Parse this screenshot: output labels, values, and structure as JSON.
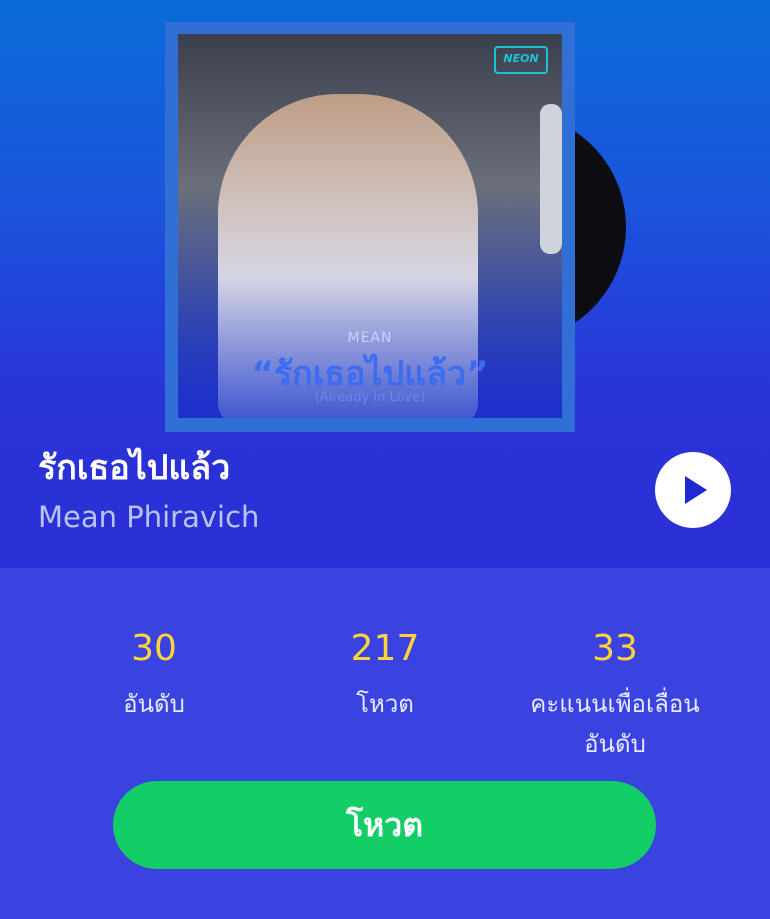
{
  "song": {
    "title": "รักเธอไปแล้ว",
    "artist": "Mean Phiravich"
  },
  "cover": {
    "badge": "NEON",
    "artist": "MEAN",
    "title": "“รักเธอไปแล้ว”",
    "subtitle": "(Already in Love)"
  },
  "stats": [
    {
      "value": "30",
      "label": "อันดับ"
    },
    {
      "value": "217",
      "label": "โหวต"
    },
    {
      "value": "33",
      "label": "คะแนนเพื่อเลื่อนอันดับ"
    }
  ],
  "vote_label": "โหวต",
  "colors": {
    "accent_yellow": "#ffd43b",
    "vote_green": "#13cd66",
    "panel_blue": "#3a43e0"
  },
  "icons": [
    "play-icon",
    "vinyl-record"
  ]
}
